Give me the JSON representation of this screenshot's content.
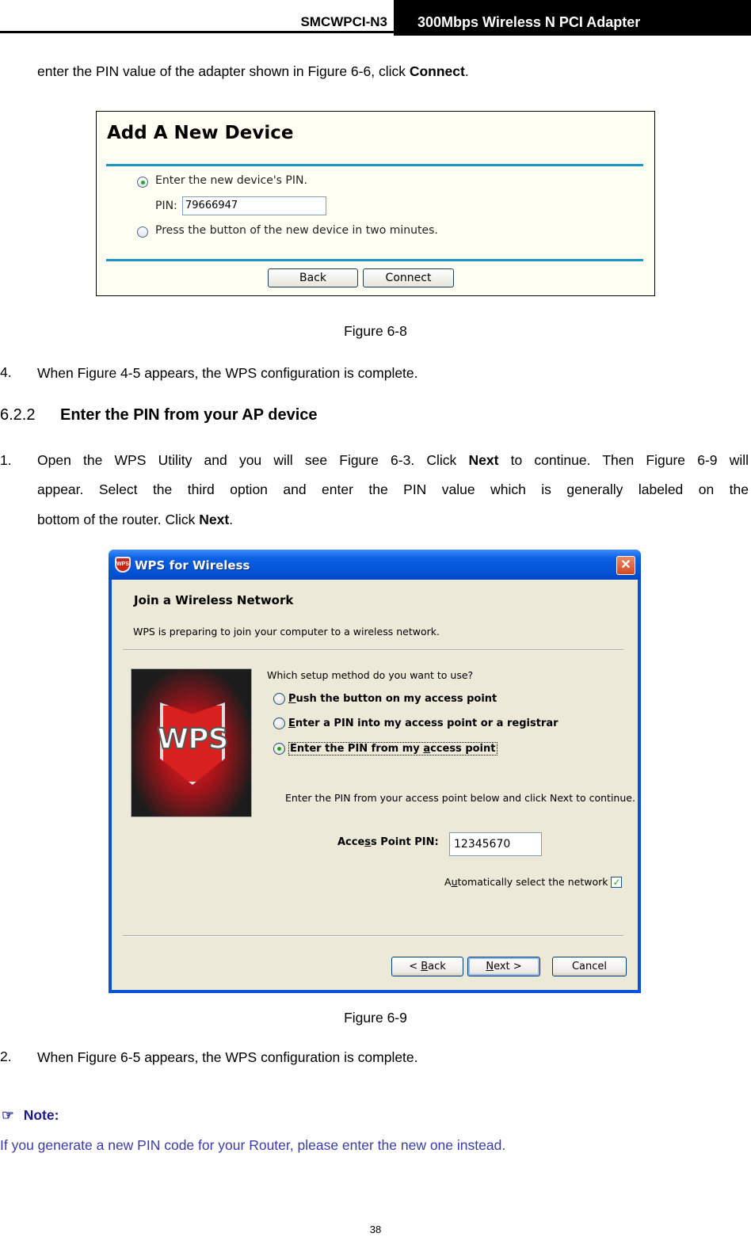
{
  "header": {
    "model": "SMCWPCI-N3",
    "product": "300Mbps Wireless N PCI Adapter"
  },
  "intro_text": {
    "before": "enter the PIN value of the adapter shown in Figure 6-6, click ",
    "bold": "Connect",
    "after": "."
  },
  "figure_6_8": {
    "title": "Add A New Device",
    "option1_label": "Enter the new device's PIN.",
    "option1_selected": true,
    "pin_label": "PIN:",
    "pin_value": "79666947",
    "option2_label": "Press the button of the new device in two minutes.",
    "option2_selected": false,
    "back_label": "Back",
    "connect_label": "Connect",
    "caption": "Figure 6-8",
    "accent_color": "#1a95c9"
  },
  "step4": {
    "number": "4.",
    "text": "When Figure 4-5 appears, the WPS configuration is complete."
  },
  "section": {
    "number": "6.2.2",
    "title": "Enter the PIN from your AP device"
  },
  "step1": {
    "number": "1.",
    "line1_a": "Open the WPS Utility and you will see Figure 6-3. Click ",
    "line1_bold": "Next",
    "line1_b": " to continue. Then Figure 6-9 will",
    "line2": "appear. Select the third option and enter the PIN value which is generally labeled on the",
    "line3_a": "bottom of the router. Click ",
    "line3_bold": "Next",
    "line3_b": "."
  },
  "figure_6_9": {
    "window_title": "WPS for Wireless",
    "app_icon": "wps-shield-icon",
    "close_icon": "close-icon",
    "heading": "Join a Wireless Network",
    "subtitle": "WPS is preparing to join your computer to a wireless network.",
    "logo_text": "WPS",
    "question": "Which setup method do you want to use?",
    "options": [
      {
        "mnemonic": "P",
        "rest": "ush the button on my access point",
        "selected": false
      },
      {
        "mnemonic": "E",
        "rest": "nter a PIN into my access point or a registrar",
        "selected": false
      },
      {
        "pre": "Enter the PIN from my ",
        "mnemonic": "a",
        "rest": "ccess point",
        "selected": true
      }
    ],
    "instruction": "Enter the PIN from your access point below and click Next to continue.",
    "ap_pin_label_pre": "Acce",
    "ap_pin_label_mn": "s",
    "ap_pin_label_post": "s Point PIN:",
    "ap_pin_value": "12345670",
    "auto_select_pre": "A",
    "auto_select_mn": "u",
    "auto_select_post": "tomatically select the network",
    "auto_select_checked": true,
    "back_pre": "< ",
    "back_mn": "B",
    "back_post": "ack",
    "next_mn": "N",
    "next_post": "ext >",
    "cancel_label": "Cancel",
    "caption": "Figure 6-9",
    "titlebar_color": "#0a5fe3",
    "client_color": "#ece9d8"
  },
  "step2": {
    "number": "2.",
    "text": "When Figure 6-5 appears, the WPS configuration is complete."
  },
  "note": {
    "icon": "pointing-hand-icon",
    "label": "Note:",
    "text": "If you generate a new PIN code for your Router, please enter the new one instead.",
    "color": "#3a3aa8"
  },
  "page_number": "38"
}
